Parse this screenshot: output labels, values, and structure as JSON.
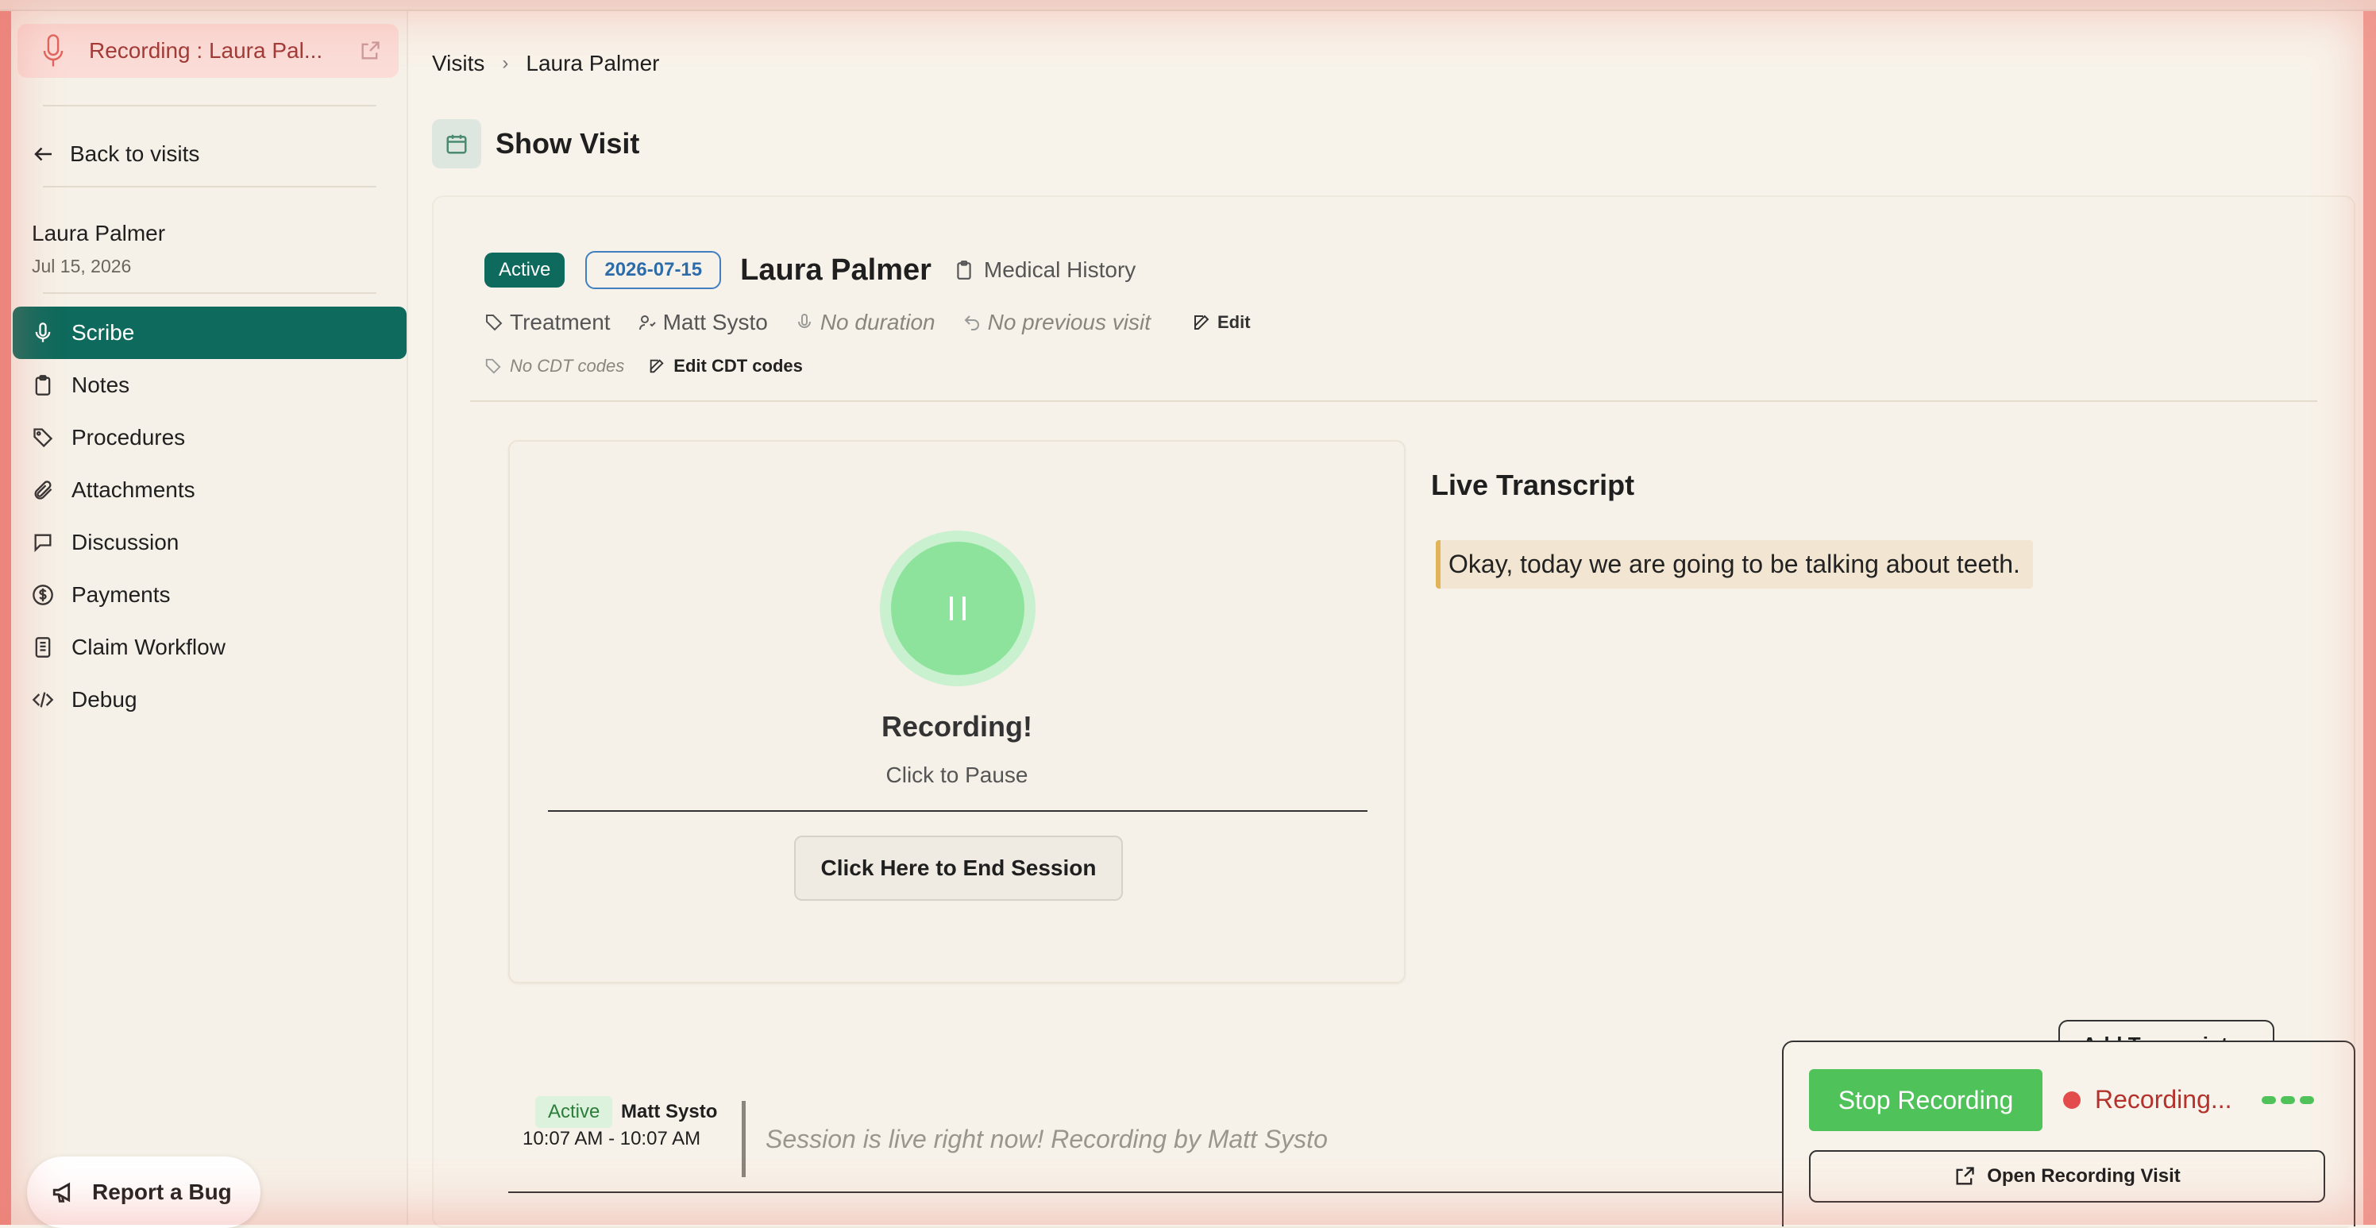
{
  "recording_chip": {
    "label": "Recording : Laura Pal...",
    "icon": "mic-icon"
  },
  "sidebar": {
    "back_label": "Back to visits",
    "patient_name": "Laura Palmer",
    "patient_date": "Jul 15, 2026",
    "items": [
      {
        "label": "Scribe",
        "icon": "mic-icon",
        "active": true
      },
      {
        "label": "Notes",
        "icon": "clipboard-icon"
      },
      {
        "label": "Procedures",
        "icon": "tag-icon"
      },
      {
        "label": "Attachments",
        "icon": "paperclip-icon"
      },
      {
        "label": "Discussion",
        "icon": "chat-icon"
      },
      {
        "label": "Payments",
        "icon": "dollar-icon"
      },
      {
        "label": "Claim Workflow",
        "icon": "document-icon"
      },
      {
        "label": "Debug",
        "icon": "code-icon"
      }
    ],
    "report_bug": "Report a Bug"
  },
  "breadcrumb": {
    "root": "Visits",
    "current": "Laura Palmer"
  },
  "page": {
    "title": "Show Visit"
  },
  "visit": {
    "status": "Active",
    "date": "2026-07-15",
    "patient": "Laura Palmer",
    "medical_history": "Medical History",
    "type": "Treatment",
    "provider": "Matt Systo",
    "duration": "No duration",
    "previous": "No previous visit",
    "edit": "Edit",
    "cdt": "No CDT codes",
    "edit_cdt": "Edit CDT codes"
  },
  "recorder": {
    "status": "Recording!",
    "hint": "Click to Pause",
    "end_session": "Click Here to End Session"
  },
  "transcript": {
    "title": "Live Transcript",
    "lines": [
      "Okay, today we are going to be talking about teeth."
    ],
    "add_button": "Add Transcript"
  },
  "session": {
    "status": "Active",
    "user": "Matt Systo",
    "time": "10:07 AM - 10:07 AM",
    "note": "Session is live right now! Recording by Matt Systo"
  },
  "floating": {
    "stop": "Stop Recording",
    "status": "Recording...",
    "open": "Open Recording Visit"
  },
  "colors": {
    "accent": "#0e6a5c",
    "recording_red": "#b5312c",
    "green": "#4fc35a"
  }
}
